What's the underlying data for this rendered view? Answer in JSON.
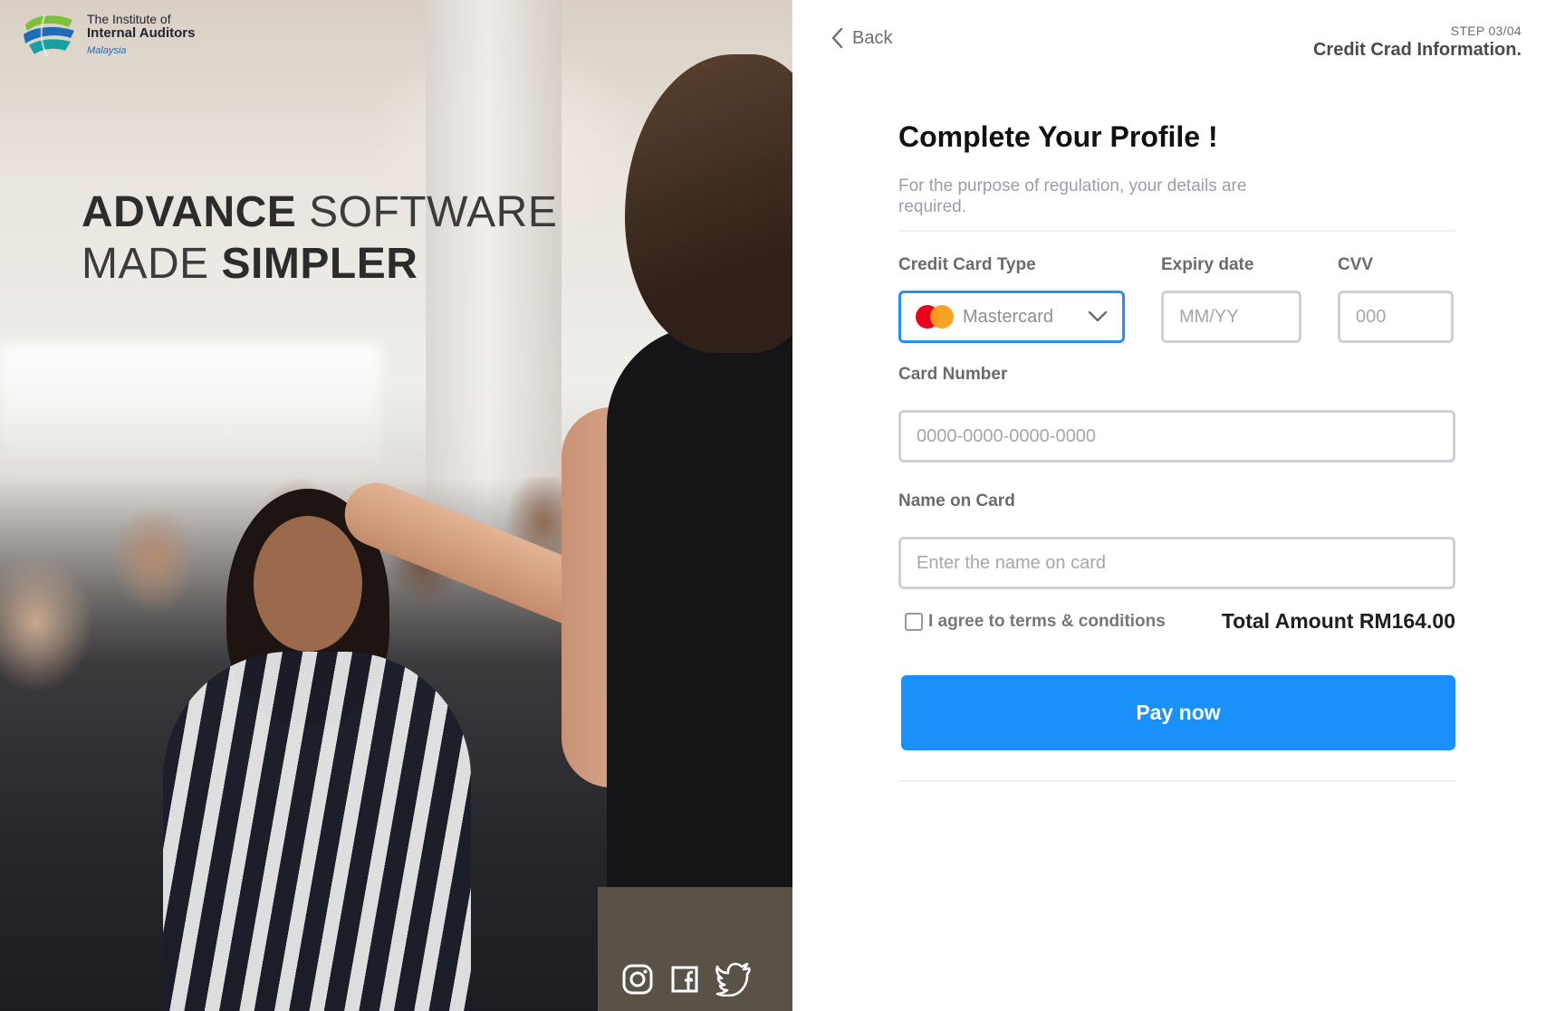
{
  "brand": {
    "line1": "The Institute of",
    "line2": "Internal Auditors",
    "line3": "Malaysia",
    "colors": {
      "green": "#7cbf3b",
      "blue": "#1f6bb5",
      "teal": "#1aa0a0"
    }
  },
  "hero": {
    "headline": {
      "line1_bold": "ADVANCE",
      "line1_rest": " SOFTWARE",
      "line2_start": "MADE ",
      "line2_bold": "SIMPLER"
    },
    "social": [
      {
        "name": "instagram-icon"
      },
      {
        "name": "facebook-icon"
      },
      {
        "name": "twitter-icon"
      }
    ]
  },
  "nav": {
    "back_label": "Back",
    "step_label": "STEP 03/04",
    "step_title": "Credit Crad Information."
  },
  "form": {
    "title": "Complete Your Profile !",
    "subtitle": "For the purpose of  regulation, your details are required.",
    "card_type": {
      "label": "Credit Card Type",
      "value": "Mastercard",
      "icon": "mastercard-icon"
    },
    "expiry": {
      "label": "Expiry date",
      "placeholder": "MM/YY"
    },
    "cvv": {
      "label": "CVV",
      "placeholder": "000"
    },
    "card_number": {
      "label": "Card Number",
      "placeholder": "0000-0000-0000-0000"
    },
    "name_on_card": {
      "label": "Name on Card",
      "placeholder": "Enter the name on card"
    },
    "terms_label": "I agree to terms & conditions",
    "total": "Total Amount RM164.00",
    "pay_label": "Pay now"
  },
  "colors": {
    "accent": "#1a90fb",
    "focus_border": "#2a8cf7",
    "input_border": "#cfcfd6"
  }
}
